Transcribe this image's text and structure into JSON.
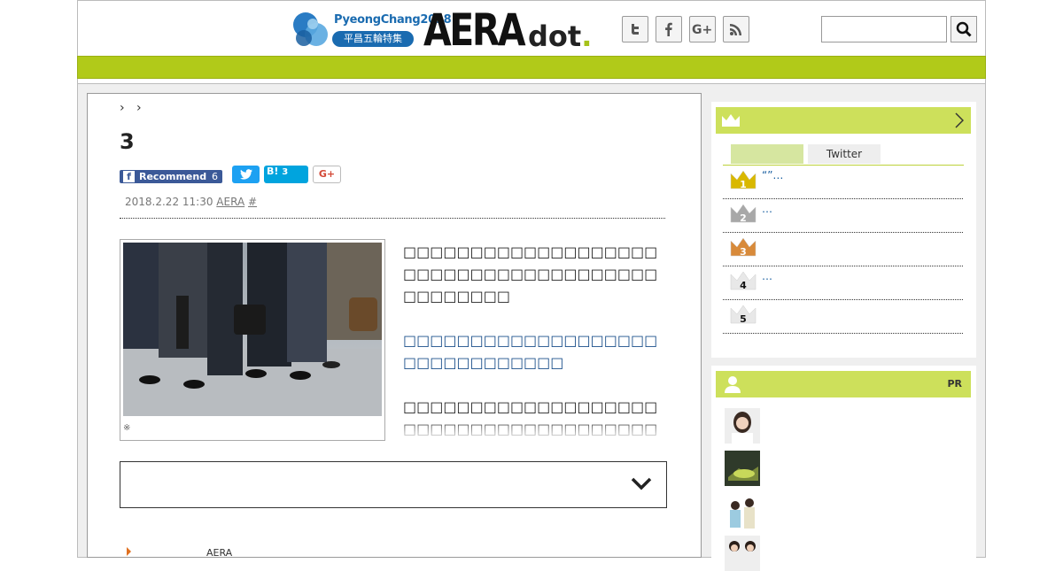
{
  "header": {
    "olympic_title": "PyeongChang2018",
    "olympic_sub": "平昌五輪特集",
    "logo_aera": "AERA",
    "logo_dot_d": "d",
    "logo_dot_o": "o",
    "logo_dot_t": "t",
    "logo_dot_dot": ".",
    "social_icons": [
      "twitter-icon",
      "facebook-icon",
      "google-plus-icon",
      "rss-icon"
    ],
    "search_value": ""
  },
  "colors": {
    "green_bar": "#b1ca19",
    "sidebar_header": "#cde05b",
    "facebook": "#3b5998",
    "twitter": "#1da1f2",
    "hatena": "#00a4de",
    "link_blue": "#1a5fa0"
  },
  "article": {
    "breadcrumb_sep1": "›",
    "breadcrumb_sep2": "›",
    "title": "3",
    "fb_label": "Recommend",
    "fb_count": "6",
    "hatena_label": "B!",
    "hatena_count": "3",
    "gplus_label": "G+",
    "date": "2018.2.22 11:30",
    "source": "AERA",
    "hash": "#",
    "photo_caption": "※",
    "para1": "□□□□□□□□□□□□□□□□□□□□□□□□□□□□□□□□□□□□□□□□□□□□□□",
    "para2": "□□□□□□□□□□□□□□□□□□□□□□□□□□□□□□□",
    "para3": "□□□□□□□□□□□□□□□□□□□□□□□□□□□□□□□□□□□□□□□□□□□□□□□□□□□□□□□□□□□□□□□□",
    "footer_source": "AERA"
  },
  "ranking": {
    "tab_active": "",
    "tab_twitter": "Twitter",
    "items": [
      {
        "num": "1",
        "text": "“”…",
        "color": "#d9b800"
      },
      {
        "num": "2",
        "text": "…",
        "color": "#a8a8a8"
      },
      {
        "num": "3",
        "text": "",
        "color": "#d88a3a"
      },
      {
        "num": "4",
        "text": "…",
        "color": "#e8e8e8"
      },
      {
        "num": "5",
        "text": "",
        "color": "#e8e8e8"
      }
    ]
  },
  "authors": {
    "pr_label": "PR"
  }
}
